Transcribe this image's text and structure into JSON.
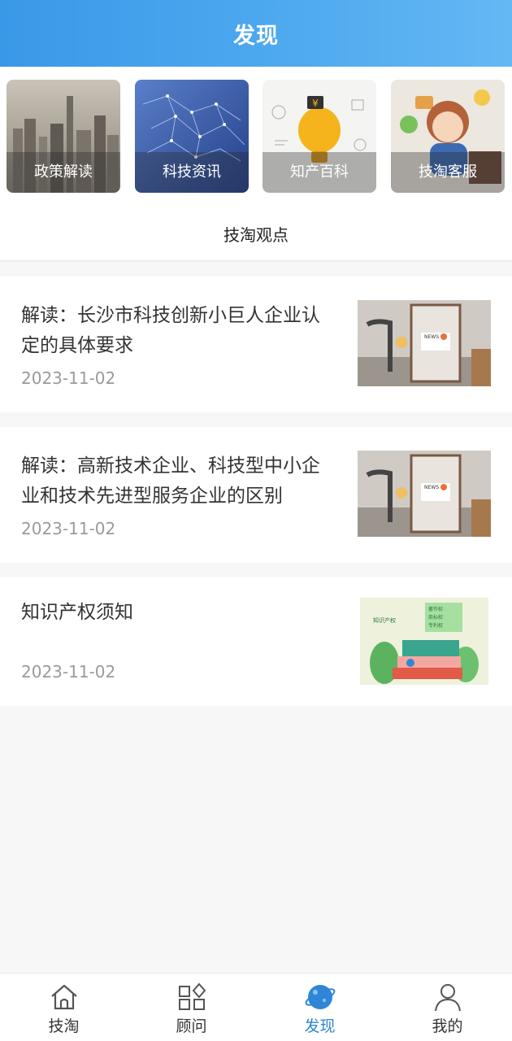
{
  "header": {
    "title": "发现"
  },
  "categories": [
    {
      "label": "政策解读",
      "icon": "city-skyline-image"
    },
    {
      "label": "科技资讯",
      "icon": "tech-network-image"
    },
    {
      "label": "知产百科",
      "icon": "lightbulb-image"
    },
    {
      "label": "技淘客服",
      "icon": "customer-service-image"
    }
  ],
  "section": {
    "title": "技淘观点"
  },
  "articles": [
    {
      "title": "解读：长沙市科技创新小巨人企业认定的具体要求",
      "date": "2023-11-02",
      "thumb": "news-frame-image"
    },
    {
      "title": "解读：高新技术企业、科技型中小企业和技术先进型服务企业的区别",
      "date": "2023-11-02",
      "thumb": "news-frame-image"
    },
    {
      "title": "知识产权须知",
      "date": "2023-11-02",
      "thumb": "ip-books-image",
      "thumb_text": [
        "知识产权",
        "著作权",
        "商标权",
        "专利权"
      ]
    }
  ],
  "tabbar": {
    "items": [
      {
        "label": "技淘",
        "icon": "home-icon"
      },
      {
        "label": "顾问",
        "icon": "grid-icon"
      },
      {
        "label": "发现",
        "icon": "planet-icon",
        "active": true
      },
      {
        "label": "我的",
        "icon": "user-icon"
      }
    ]
  },
  "colors": {
    "header": "#4aa5ee",
    "active_tab": "#2f86d6"
  }
}
